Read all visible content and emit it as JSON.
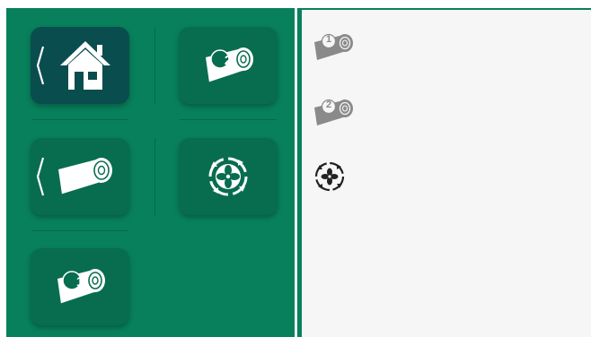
{
  "left_panel": {
    "tiles": [
      {
        "name": "home",
        "icon": "home-icon",
        "badge": "",
        "has_back": true,
        "selected": true
      },
      {
        "name": "roller-2",
        "icon": "roller-shutter-icon",
        "badge": "2",
        "has_back": false,
        "selected": false
      },
      {
        "name": "roller-all",
        "icon": "roller-shutter-icon",
        "badge": "",
        "has_back": true,
        "selected": false
      },
      {
        "name": "fan",
        "icon": "ventilation-fan-icon",
        "badge": "",
        "has_back": false,
        "selected": false
      },
      {
        "name": "roller-1",
        "icon": "roller-shutter-icon",
        "badge": "1",
        "has_back": false,
        "selected": false
      }
    ]
  },
  "right_panel": {
    "items": [
      {
        "name": "roller-1",
        "icon": "roller-shutter-icon",
        "badge": "1"
      },
      {
        "name": "roller-2",
        "icon": "roller-shutter-icon",
        "badge": "2"
      },
      {
        "name": "fan",
        "icon": "ventilation-fan-icon",
        "badge": ""
      }
    ]
  },
  "colors": {
    "panel_green": "#08805c",
    "tile_green": "#086d4f",
    "tile_selected": "#0a4d4f",
    "right_background": "#f6f6f6",
    "icon_white": "#ffffff",
    "icon_gray": "#8a8a8a"
  }
}
